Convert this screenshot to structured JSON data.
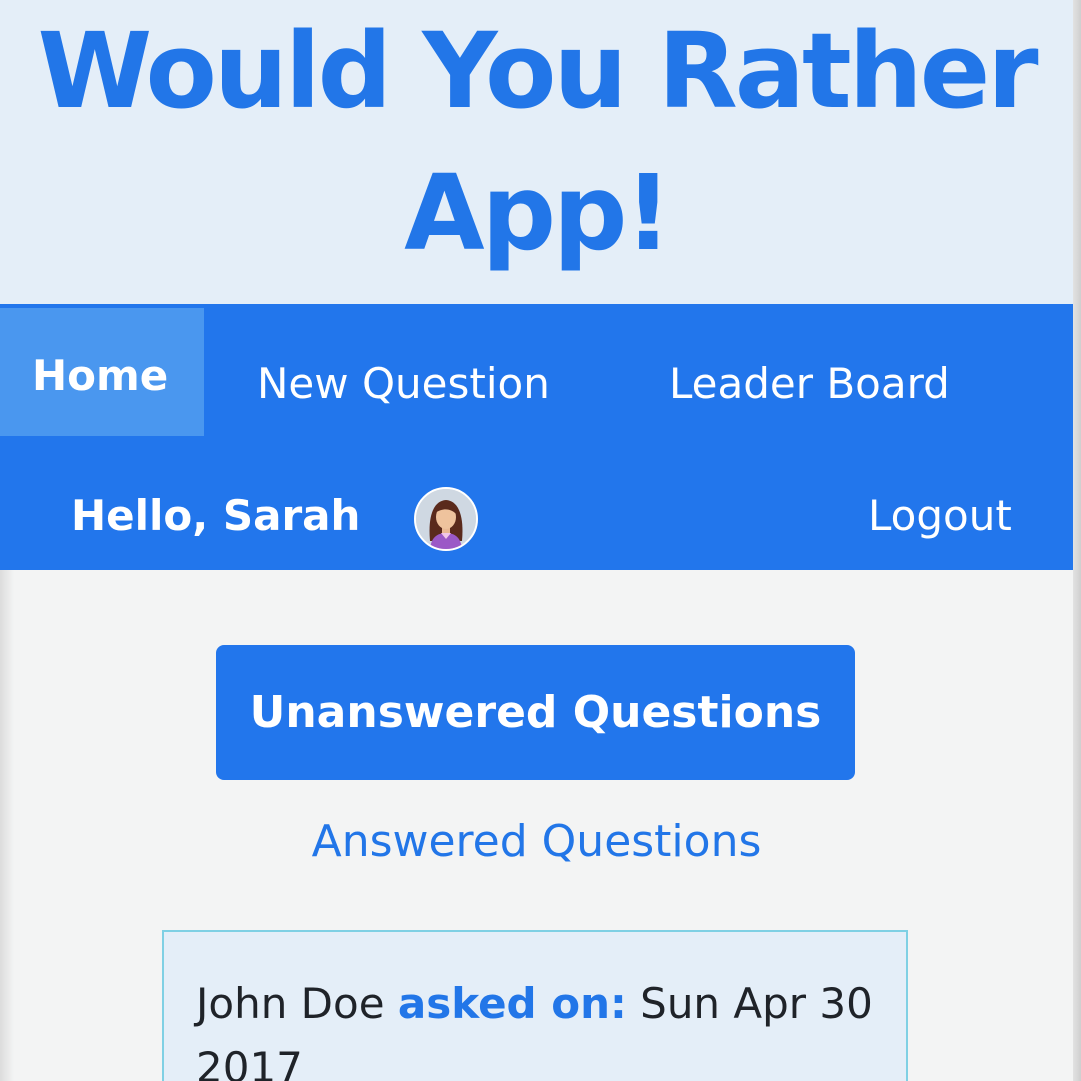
{
  "app": {
    "title": "Would You Rather App!"
  },
  "nav": {
    "items": [
      {
        "label": "Home",
        "active": true
      },
      {
        "label": "New Question",
        "active": false
      },
      {
        "label": "Leader Board",
        "active": false
      }
    ],
    "greeting": "Hello, Sarah",
    "avatar_icon": "female-user-avatar",
    "logout_label": "Logout"
  },
  "toggles": {
    "unanswered_label": "Unanswered Questions",
    "answered_label": "Answered Questions"
  },
  "question": {
    "author": "John Doe",
    "asked_label": "asked on:",
    "date": "Sun Apr 30 2017"
  },
  "colors": {
    "primary": "#2276ec",
    "banner_bg": "#e4eef8",
    "active_nav": "#4a97ef",
    "card_border": "#7fd0e4",
    "page_bg": "#f3f4f4"
  }
}
